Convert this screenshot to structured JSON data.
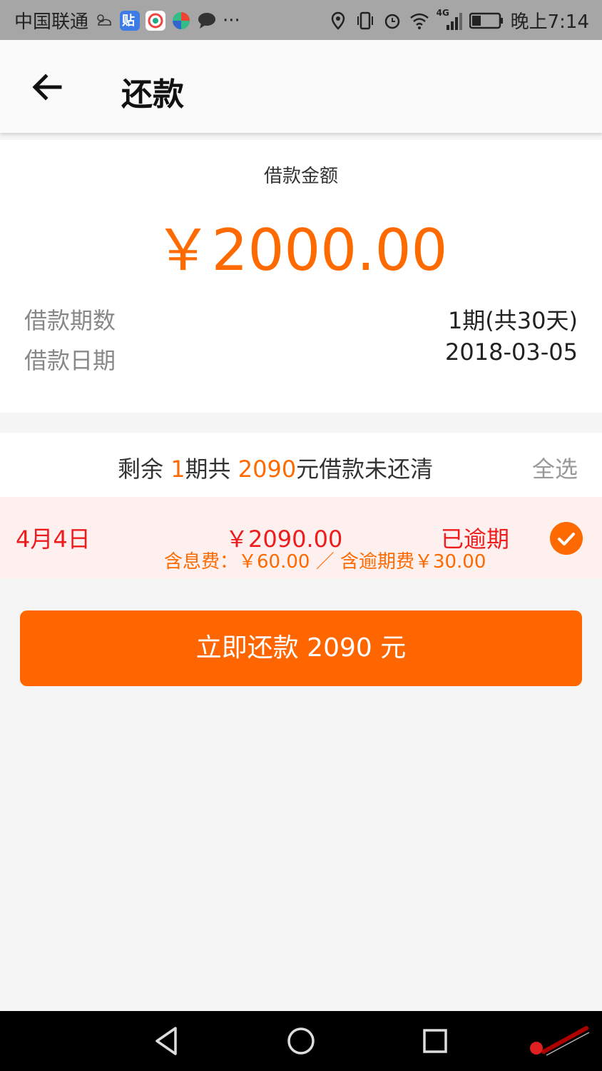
{
  "status_bar": {
    "carrier": "中国联通",
    "app_icons": [
      "weather-icon",
      "tieba-icon",
      "browser-icon",
      "app-icon",
      "message-icon"
    ],
    "more": "···",
    "network": "4G",
    "time": "晚上7:14"
  },
  "header": {
    "back_icon": "back-arrow-icon",
    "title": "还款"
  },
  "loan": {
    "amount_label": "借款金额",
    "amount": "￥2000.00",
    "term_label": "借款期数",
    "term_value": "1期(共30天)",
    "date_label": "借款日期",
    "date_value": "2018-03-05"
  },
  "summary": {
    "prefix": "剩余 ",
    "periods": "1",
    "middle": "期共 ",
    "total": "2090",
    "suffix": "元借款未还清",
    "select_all": "全选"
  },
  "installment": {
    "date": "4月4日",
    "amount": "￥2090.00",
    "status": "已逾期",
    "fees": "含息费：￥60.00 ／ 含逾期费￥30.00",
    "selected": true
  },
  "pay_button": "立即还款 2090 元",
  "colors": {
    "accent": "#ff6a00",
    "overdue": "#ee1c1c",
    "item_bg": "#fdf0ef"
  }
}
